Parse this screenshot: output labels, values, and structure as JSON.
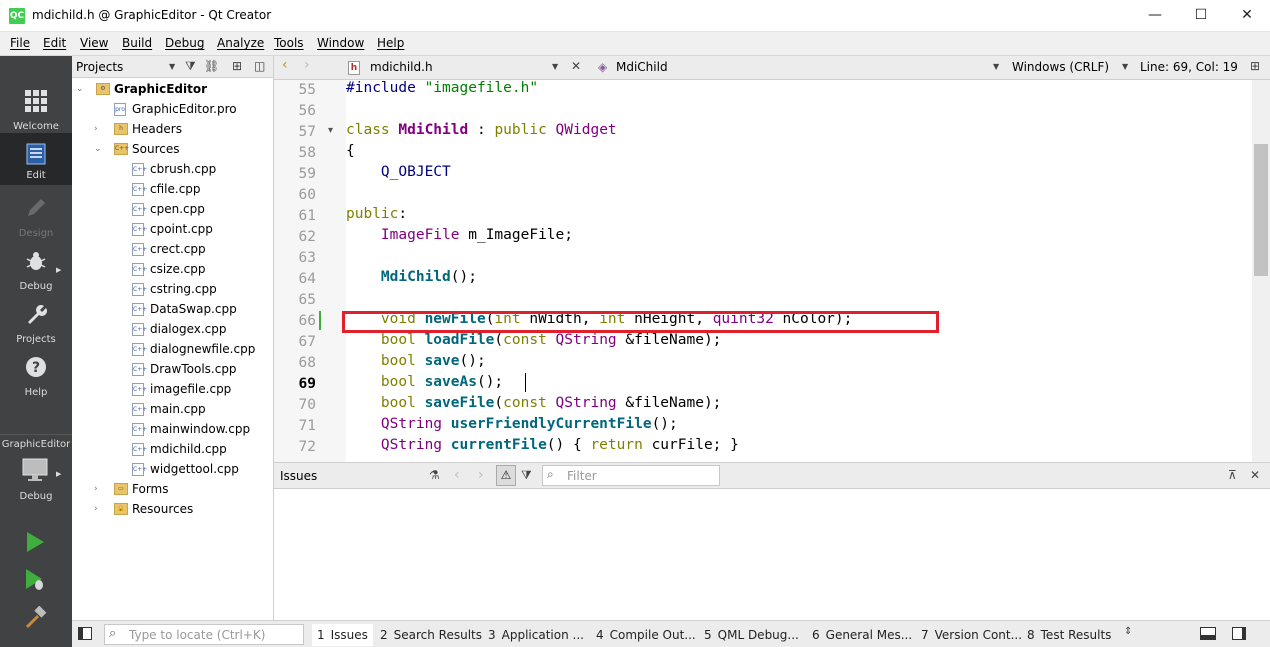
{
  "window": {
    "title": "mdichild.h @ GraphicEditor - Qt Creator",
    "logo": "QC",
    "minimize": "—",
    "maximize": "☐",
    "close": "✕"
  },
  "menu": [
    "File",
    "Edit",
    "View",
    "Build",
    "Debug",
    "Analyze",
    "Tools",
    "Window",
    "Help"
  ],
  "modes": [
    {
      "label": "Welcome",
      "icon": "grid-icon",
      "state": "normal"
    },
    {
      "label": "Edit",
      "icon": "document-icon",
      "state": "active"
    },
    {
      "label": "Design",
      "icon": "pencil-icon",
      "state": "disabled"
    },
    {
      "label": "Debug",
      "icon": "bug-icon",
      "state": "normal"
    },
    {
      "label": "Projects",
      "icon": "wrench-icon",
      "state": "normal"
    },
    {
      "label": "Help",
      "icon": "help-icon",
      "state": "normal"
    }
  ],
  "kit": {
    "project": "GraphicEditor",
    "mode": "Debug"
  },
  "projects_panel": {
    "title": "Projects"
  },
  "tree": {
    "root": "GraphicEditor",
    "pro": "GraphicEditor.pro",
    "headers": "Headers",
    "sources": "Sources",
    "files": [
      "cbrush.cpp",
      "cfile.cpp",
      "cpen.cpp",
      "cpoint.cpp",
      "crect.cpp",
      "csize.cpp",
      "cstring.cpp",
      "DataSwap.cpp",
      "dialogex.cpp",
      "dialognewfile.cpp",
      "DrawTools.cpp",
      "imagefile.cpp",
      "main.cpp",
      "mainwindow.cpp",
      "mdichild.cpp",
      "widgettool.cpp"
    ],
    "forms": "Forms",
    "resources": "Resources"
  },
  "editor": {
    "file": "mdichild.h",
    "symbol": "MdiChild",
    "line_ending": "Windows (CRLF)",
    "position": "Line: 69, Col: 19",
    "current_line": 69,
    "highlighted_line": 66
  },
  "code": [
    {
      "n": "55",
      "tokens": [
        {
          "t": "#include ",
          "c": "mc"
        },
        {
          "t": "\"imagefile.h\"",
          "c": "st"
        }
      ]
    },
    {
      "n": "56",
      "tokens": []
    },
    {
      "n": "57",
      "fold": true,
      "tokens": [
        {
          "t": "class ",
          "c": "kw"
        },
        {
          "t": "MdiChild",
          "c": "ty b"
        },
        {
          "t": " : "
        },
        {
          "t": "public ",
          "c": "kw"
        },
        {
          "t": "QWidget",
          "c": "ty"
        }
      ]
    },
    {
      "n": "58",
      "tokens": [
        {
          "t": "{"
        }
      ]
    },
    {
      "n": "59",
      "tokens": [
        {
          "t": "    Q_OBJECT",
          "c": "mc"
        }
      ]
    },
    {
      "n": "60",
      "tokens": []
    },
    {
      "n": "61",
      "tokens": [
        {
          "t": "public",
          "c": "kw"
        },
        {
          "t": ":"
        }
      ]
    },
    {
      "n": "62",
      "tokens": [
        {
          "t": "    "
        },
        {
          "t": "ImageFile",
          "c": "ty"
        },
        {
          "t": " m_ImageFile;"
        }
      ]
    },
    {
      "n": "63",
      "tokens": []
    },
    {
      "n": "64",
      "tokens": [
        {
          "t": "    "
        },
        {
          "t": "MdiChild",
          "c": "fn"
        },
        {
          "t": "();"
        }
      ]
    },
    {
      "n": "65",
      "tokens": []
    },
    {
      "n": "66",
      "tokens": [
        {
          "t": "    "
        },
        {
          "t": "void ",
          "c": "kw"
        },
        {
          "t": "newFile",
          "c": "fn"
        },
        {
          "t": "("
        },
        {
          "t": "int ",
          "c": "kw"
        },
        {
          "t": "nWidth, "
        },
        {
          "t": "int ",
          "c": "kw"
        },
        {
          "t": "nHeight, "
        },
        {
          "t": "quint32",
          "c": "ty"
        },
        {
          "t": " nColor);"
        }
      ]
    },
    {
      "n": "67",
      "tokens": [
        {
          "t": "    "
        },
        {
          "t": "bool ",
          "c": "kw"
        },
        {
          "t": "loadFile",
          "c": "fn"
        },
        {
          "t": "("
        },
        {
          "t": "const ",
          "c": "kw"
        },
        {
          "t": "QString",
          "c": "ty"
        },
        {
          "t": " &fileName);"
        }
      ]
    },
    {
      "n": "68",
      "tokens": [
        {
          "t": "    "
        },
        {
          "t": "bool ",
          "c": "kw"
        },
        {
          "t": "save",
          "c": "fn"
        },
        {
          "t": "();"
        }
      ]
    },
    {
      "n": "69",
      "tokens": [
        {
          "t": "    "
        },
        {
          "t": "bool ",
          "c": "kw"
        },
        {
          "t": "saveAs",
          "c": "fn"
        },
        {
          "t": "();"
        }
      ]
    },
    {
      "n": "70",
      "tokens": [
        {
          "t": "    "
        },
        {
          "t": "bool ",
          "c": "kw"
        },
        {
          "t": "saveFile",
          "c": "fn"
        },
        {
          "t": "("
        },
        {
          "t": "const ",
          "c": "kw"
        },
        {
          "t": "QString",
          "c": "ty"
        },
        {
          "t": " &fileName);"
        }
      ]
    },
    {
      "n": "71",
      "tokens": [
        {
          "t": "    "
        },
        {
          "t": "QString",
          "c": "ty"
        },
        {
          "t": " "
        },
        {
          "t": "userFriendlyCurrentFile",
          "c": "fn"
        },
        {
          "t": "();"
        }
      ]
    },
    {
      "n": "72",
      "tokens": [
        {
          "t": "    "
        },
        {
          "t": "QString",
          "c": "ty"
        },
        {
          "t": " "
        },
        {
          "t": "currentFile",
          "c": "fn"
        },
        {
          "t": "() { "
        },
        {
          "t": "return ",
          "c": "kw"
        },
        {
          "t": "curFile; }"
        }
      ]
    }
  ],
  "issues": {
    "title": "Issues",
    "filter_placeholder": "Filter"
  },
  "status": {
    "locator_placeholder": "Type to locate (Ctrl+K)",
    "tabs": [
      {
        "num": "1",
        "label": "Issues"
      },
      {
        "num": "2",
        "label": "Search Results"
      },
      {
        "num": "3",
        "label": "Application ..."
      },
      {
        "num": "4",
        "label": "Compile Out..."
      },
      {
        "num": "5",
        "label": "QML Debug..."
      },
      {
        "num": "6",
        "label": "General Mes..."
      },
      {
        "num": "7",
        "label": "Version Cont..."
      },
      {
        "num": "8",
        "label": "Test Results"
      }
    ]
  },
  "colors": {
    "modebar": "#404244",
    "highlight_box": "#e0202a",
    "run": "#3fae3f"
  }
}
